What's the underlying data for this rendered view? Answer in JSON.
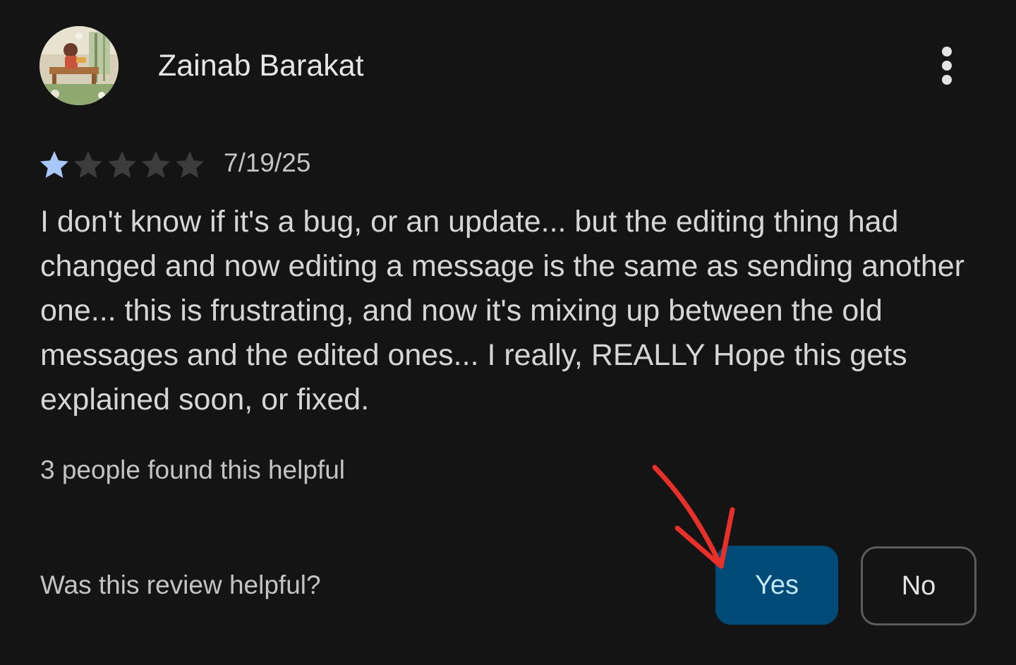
{
  "review": {
    "reviewer_name": "Zainab Barakat",
    "avatar_icon": "avatar-illustration-icon",
    "menu_icon": "more-vert-icon",
    "rating": {
      "value": 1,
      "max": 5,
      "filled_color": "#a8c7fa",
      "empty_color": "#3c3c3c"
    },
    "date": "7/19/25",
    "body": "I don't know if it's a bug, or an update... but the editing thing had changed and now editing a message is the same as sending another one... this is frustrating, and now it's mixing up between the old messages and the edited ones... I really, REALLY Hope this gets explained soon, or fixed.",
    "helpful_count_text": "3 people found this helpful",
    "helpful_question": "Was this review helpful?",
    "yes_label": "Yes",
    "no_label": "No"
  },
  "colors": {
    "background": "#141414",
    "yes_button_bg": "#004a77",
    "yes_button_text": "#c2e7ff",
    "annotation": "#e8302a"
  }
}
